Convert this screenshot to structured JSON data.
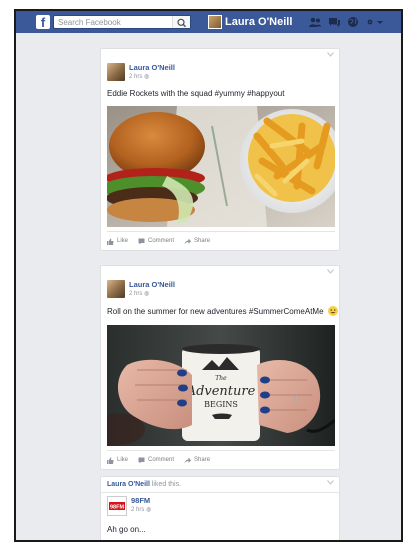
{
  "topbar": {
    "logo_letter": "f",
    "search_placeholder": "Search Facebook",
    "user_name": "Laura O'Neill",
    "icons": [
      "friend-requests-icon",
      "messages-icon",
      "globe-icon",
      "settings-menu-icon"
    ]
  },
  "posts": [
    {
      "author": "Laura O'Neill",
      "time": "2 hrs",
      "text": "Eddie Rockets with the squad #yummy #happyout",
      "photo": "burger-and-fries-photo",
      "actions": {
        "like": "Like",
        "comment": "Comment",
        "share": "Share"
      }
    },
    {
      "author": "Laura O'Neill",
      "time": "2 hrs",
      "text": "Roll on the summer for new adventures #SummerComeAtMe",
      "emoji": "grinning-face-emoji",
      "photo": "adventure-mug-photo",
      "mug_text_line1": "The",
      "mug_text_line2": "Adventure",
      "mug_text_line3": "BEGINS",
      "actions": {
        "like": "Like",
        "comment": "Comment",
        "share": "Share"
      }
    }
  ],
  "activity": {
    "actor": "Laura O'Neill",
    "verb": "liked this.",
    "page_name": "98FM",
    "page_logo_text": "98FM",
    "time": "2 hrs",
    "text": "Ah go on..."
  },
  "colors": {
    "brand": "#3b5998",
    "link": "#365899",
    "background": "#e9ebee",
    "muted": "#90949c"
  }
}
